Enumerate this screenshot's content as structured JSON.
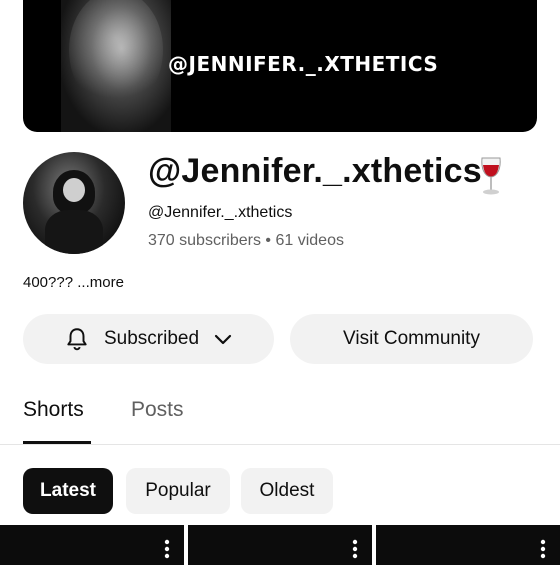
{
  "banner": {
    "text": "@JENNIFER._.XTHETICS"
  },
  "channel": {
    "name": "@Jennifer._.xthetics",
    "emoji": "wine-glass-icon",
    "handle": "@Jennifer._.xthetics",
    "subscribers": "370 subscribers",
    "separator": "•",
    "videos": "61 videos",
    "description": "400???",
    "more_label": "...more"
  },
  "actions": {
    "subscribed_label": "Subscribed",
    "community_label": "Visit Community"
  },
  "tabs": [
    {
      "label": "Shorts",
      "active": true
    },
    {
      "label": "Posts",
      "active": false
    }
  ],
  "filters": [
    {
      "label": "Latest",
      "selected": true
    },
    {
      "label": "Popular",
      "selected": false
    },
    {
      "label": "Oldest",
      "selected": false
    }
  ],
  "colors": {
    "text": "#0f0f0f",
    "secondary_text": "#606060",
    "button_bg": "#f2f2f2",
    "selected_chip_bg": "#0f0f0f"
  }
}
